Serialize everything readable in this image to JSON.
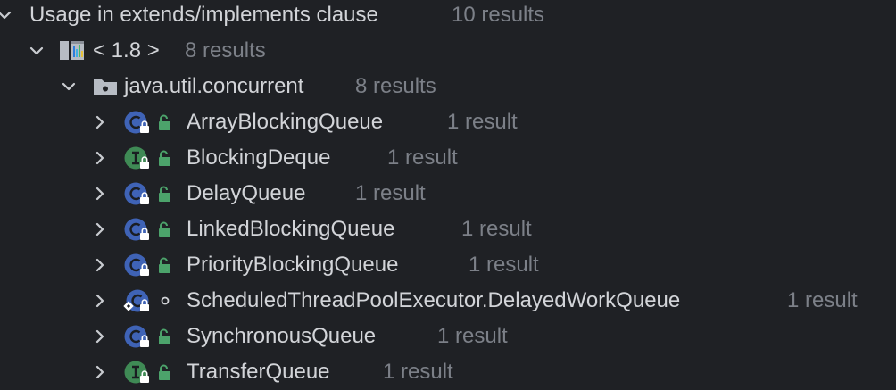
{
  "group": {
    "label": "Usage in extends/implements clause",
    "count": "10 results"
  },
  "library": {
    "label": "< 1.8 >",
    "count": "8 results"
  },
  "package": {
    "label": "java.util.concurrent",
    "count": "8 results"
  },
  "items": [
    {
      "kind": "class",
      "access": "public",
      "label": "ArrayBlockingQueue",
      "count": "1 result"
    },
    {
      "kind": "interface",
      "access": "public",
      "label": "BlockingDeque",
      "count": "1 result"
    },
    {
      "kind": "class",
      "access": "public",
      "label": "DelayQueue",
      "count": "1 result"
    },
    {
      "kind": "class",
      "access": "public",
      "label": "LinkedBlockingQueue",
      "count": "1 result"
    },
    {
      "kind": "class",
      "access": "public",
      "label": "PriorityBlockingQueue",
      "count": "1 result"
    },
    {
      "kind": "class",
      "access": "package-private",
      "label": "ScheduledThreadPoolExecutor.DelayedWorkQueue",
      "count": "1 result"
    },
    {
      "kind": "class",
      "access": "public",
      "label": "SynchronousQueue",
      "count": "1 result"
    },
    {
      "kind": "interface",
      "access": "public",
      "label": "TransferQueue",
      "count": "1 result"
    }
  ],
  "colors": {
    "background": "#1f2125",
    "text": "#d2d4d8",
    "muted": "#7c8088",
    "class_icon": "#3f63b6",
    "interface_icon": "#3f8a55",
    "lock": "#4ca36b"
  }
}
